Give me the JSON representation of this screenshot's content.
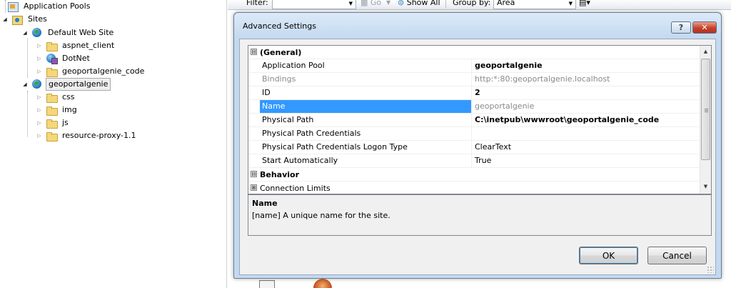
{
  "tree": {
    "items": [
      {
        "label": "Application Pools",
        "icon": "pool-icon"
      },
      {
        "label": "Sites",
        "icon": "sites-icon"
      },
      {
        "label": "Default Web Site",
        "icon": "globe-icon"
      },
      {
        "label": "aspnet_client",
        "icon": "folder-icon"
      },
      {
        "label": "DotNet",
        "icon": "dotnet-app-icon"
      },
      {
        "label": "geoportalgenie_code",
        "icon": "folder-icon"
      },
      {
        "label": "geoportalgenie",
        "icon": "globe-icon"
      },
      {
        "label": "css",
        "icon": "folder-icon"
      },
      {
        "label": "img",
        "icon": "folder-icon"
      },
      {
        "label": "js",
        "icon": "folder-icon"
      },
      {
        "label": "resource-proxy-1.1",
        "icon": "folder-icon"
      }
    ]
  },
  "toolbar": {
    "filter_label": "Filter:",
    "go_label": "Go",
    "show_all_label": "Show All",
    "group_by_label": "Group by:",
    "group_by_value": "Area"
  },
  "dialog": {
    "title": "Advanced Settings",
    "help_label": "?",
    "close_label": "✕",
    "ok_label": "OK",
    "cancel_label": "Cancel"
  },
  "grid": {
    "general_category": "(General)",
    "rows": [
      {
        "name": "Application Pool",
        "value": "geoportalgenie"
      },
      {
        "name": "Bindings",
        "value": "http:*:80:geoportalgenie.localhost"
      },
      {
        "name": "ID",
        "value": "2"
      },
      {
        "name": "Name",
        "value": "geoportalgenie"
      },
      {
        "name": "Physical Path",
        "value": "C:\\inetpub\\wwwroot\\geoportalgenie_code"
      },
      {
        "name": "Physical Path Credentials",
        "value": ""
      },
      {
        "name": "Physical Path Credentials Logon Type",
        "value": "ClearText"
      },
      {
        "name": "Start Automatically",
        "value": "True"
      }
    ],
    "behavior_category": "Behavior",
    "connection_limits": "Connection Limits",
    "expand_symbol": "⊞",
    "collapse_symbol": "⊟"
  },
  "description": {
    "title": "Name",
    "text": "[name] A unique name for the site."
  },
  "colors": {
    "selection": "#3399ff",
    "dialog_frame": "#c3d9f0",
    "close_button": "#c7402b"
  }
}
